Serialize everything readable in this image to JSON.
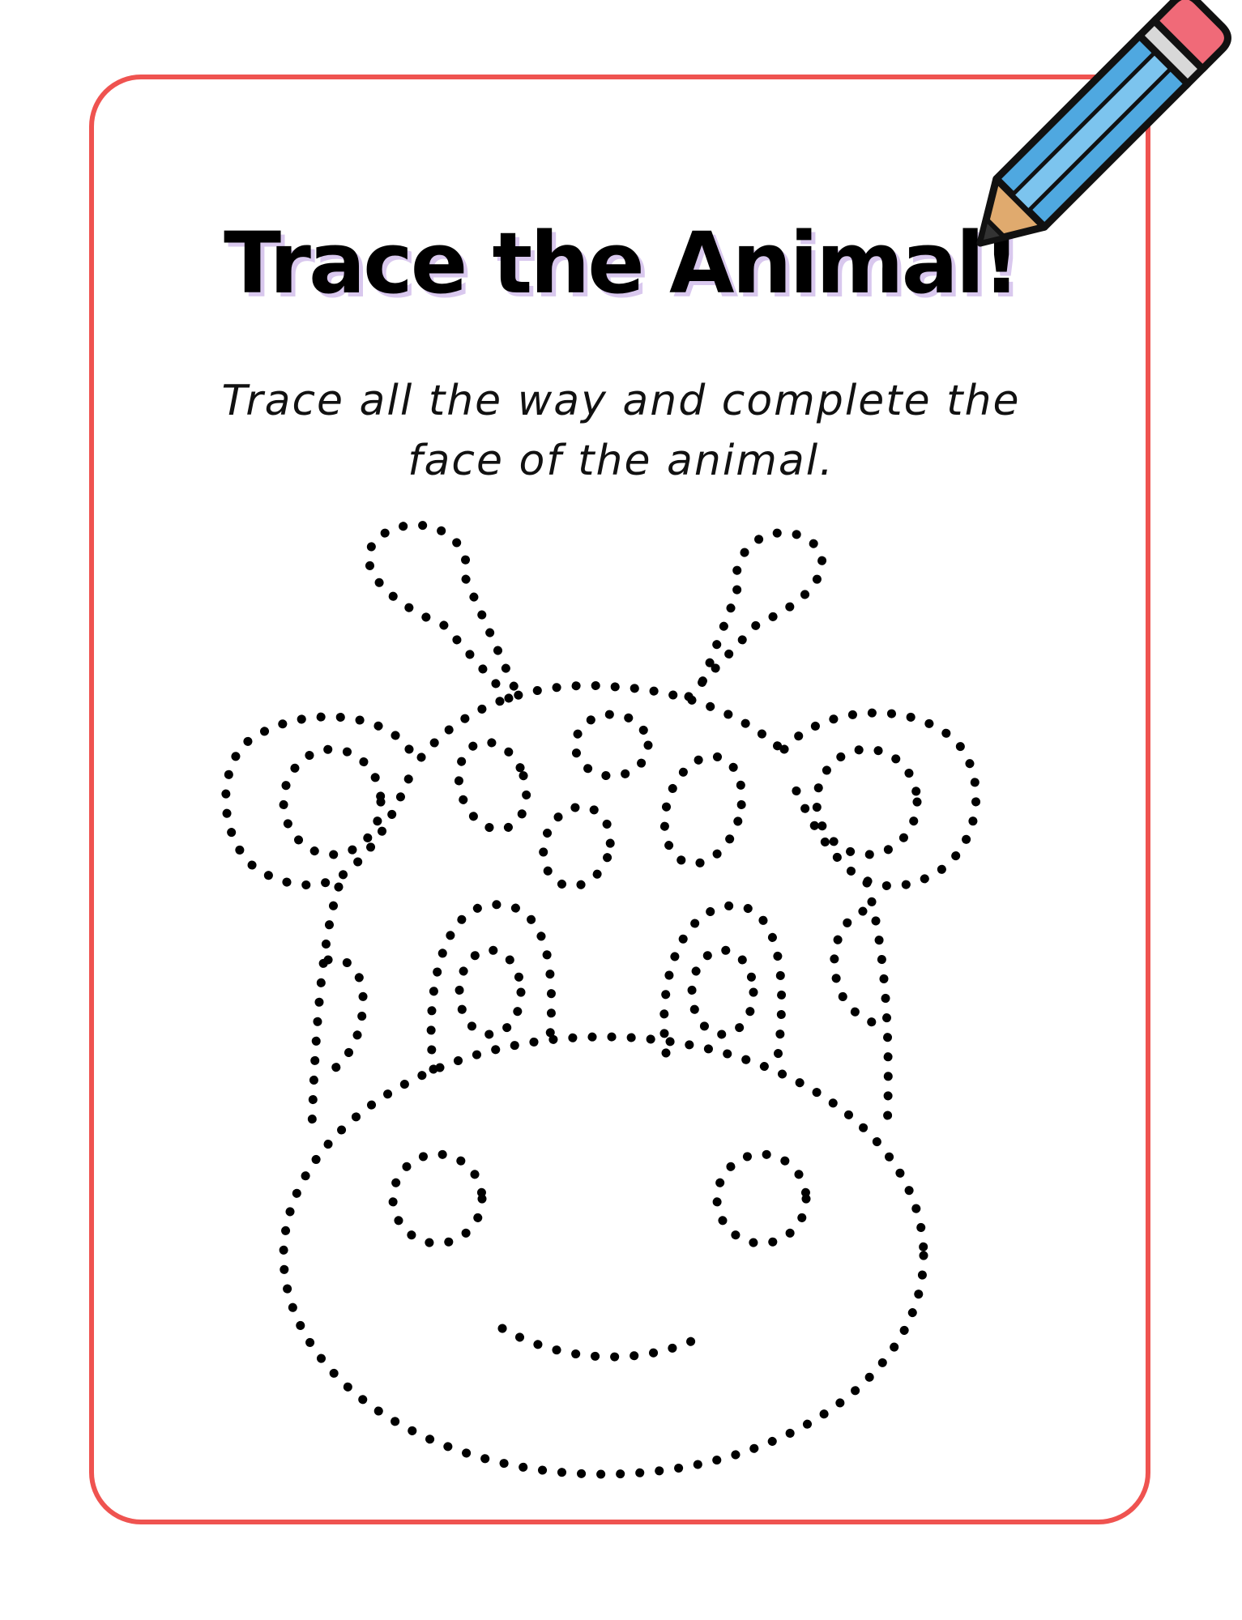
{
  "worksheet": {
    "title": "Trace the Animal!",
    "instructions_line1": "Trace all the way and complete the",
    "instructions_line2": "face of the animal."
  },
  "colors": {
    "frame": "#ef5350",
    "title_shadow": "#d9c8ee",
    "pencil_body": "#4fa8e0",
    "pencil_eraser": "#f06a78",
    "pencil_wood": "#e0aa6e"
  },
  "icons": {
    "decoration": "pencil-icon",
    "drawing": "dotted-giraffe-face"
  }
}
